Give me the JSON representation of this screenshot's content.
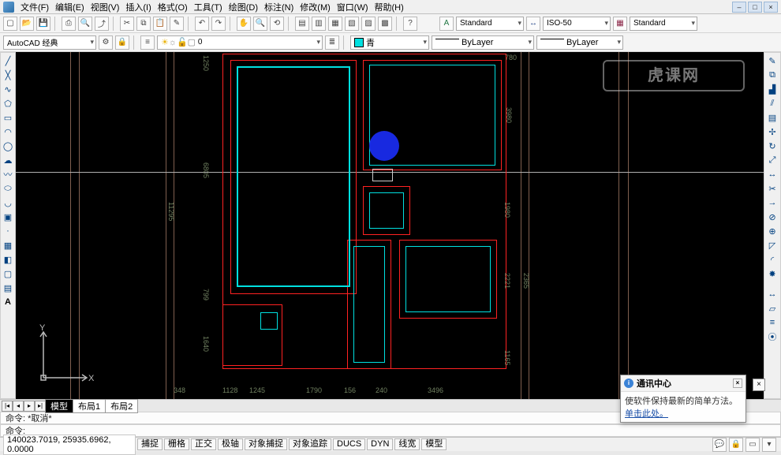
{
  "menu": {
    "items": [
      "文件(F)",
      "编辑(E)",
      "视图(V)",
      "插入(I)",
      "格式(O)",
      "工具(T)",
      "绘图(D)",
      "标注(N)",
      "修改(M)",
      "窗口(W)",
      "帮助(H)"
    ]
  },
  "toolbar1": {
    "workspace_combo": "AutoCAD 经典"
  },
  "toolbar2": {
    "style_combo": "Standard",
    "dimstyle_combo": "ISO-50",
    "tablestyle_combo": "Standard",
    "layer_color_label": "青",
    "linetype_combo": "ByLayer",
    "lineweight_combo": "ByLayer"
  },
  "dims": {
    "a": "1250",
    "b": "780",
    "c": "11295",
    "d": "6805",
    "e": "3980",
    "f": "1980",
    "g": "799",
    "h": "1640",
    "i": "1245",
    "j": "1790",
    "k": "1128",
    "l": "156",
    "m": "3496",
    "n": "240",
    "o": "2221",
    "p": "2365",
    "q": "1165",
    "r": "348"
  },
  "ucs": {
    "x": "X",
    "y": "Y"
  },
  "tabs": {
    "model": "模型",
    "layout1": "布局1",
    "layout2": "布局2"
  },
  "command": {
    "prompt1": "命令: *取消*",
    "prompt2": "命令:"
  },
  "status": {
    "coords": "140023.7019, 25935.6962, 0.0000",
    "buttons": [
      "捕捉",
      "栅格",
      "正交",
      "极轴",
      "对象捕捉",
      "对象追踪",
      "DUCS",
      "DYN",
      "线宽",
      "模型"
    ]
  },
  "popup": {
    "title": "通讯中心",
    "body": "使软件保持最新的简单方法。",
    "link": "单击此处。"
  },
  "watermark": "虎课网"
}
